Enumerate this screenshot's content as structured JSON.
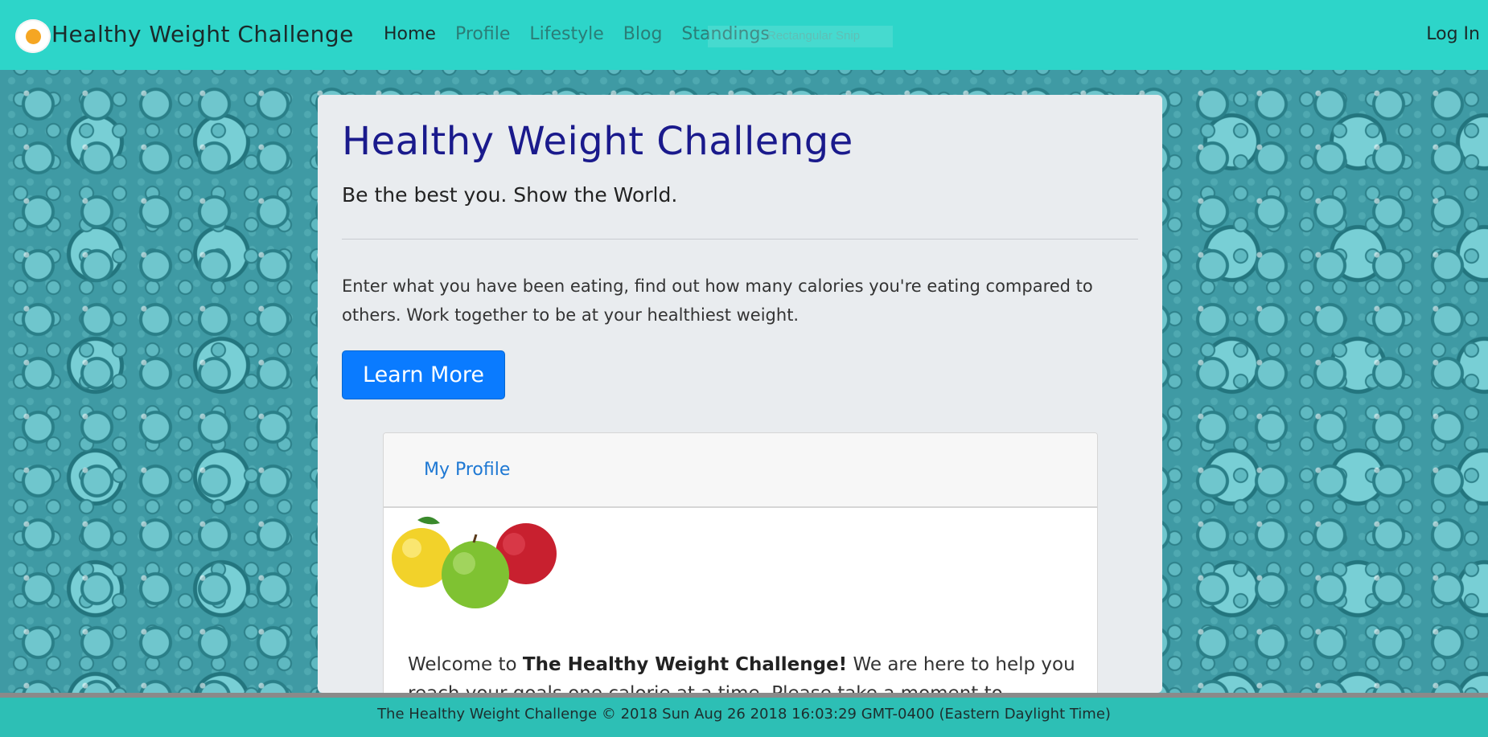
{
  "navbar": {
    "brand": "Healthy Weight Challenge",
    "links": [
      "Home",
      "Profile",
      "Lifestyle",
      "Blog",
      "Standings"
    ],
    "snip_overlay": "Rectangular Snip",
    "login": "Log In"
  },
  "jumbotron": {
    "title": "Healthy Weight Challenge",
    "lead": "Be the best you. Show the World.",
    "text": "Enter what you have been eating, find out how many calories you're eating compared to others. Work together to be at your healthiest weight.",
    "button": "Learn More"
  },
  "card": {
    "tab": "My Profile",
    "welcome_pre": "Welcome to ",
    "welcome_bold": "The Healthy Weight Challenge!",
    "welcome_post": " We are here to help you reach your goals one calorie at a time. Please take a moment to"
  },
  "footer": {
    "text": "The Healthy Weight Challenge © 2018 Sun Aug 26 2018 16:03:29 GMT-0400 (Eastern Daylight Time)"
  },
  "colors": {
    "navbar": "#2dd5c9",
    "title": "#1a1a8c",
    "button": "#0a7bff",
    "footer": "#2dbfb5"
  },
  "icons": [
    "fried-egg-logo-icon",
    "apples-image"
  ]
}
